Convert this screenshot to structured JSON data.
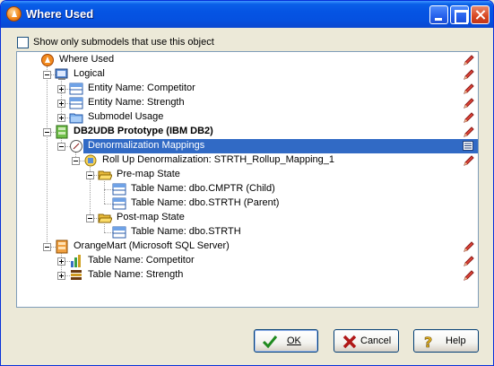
{
  "window": {
    "title": "Where Used"
  },
  "options": {
    "show_only_label": "Show only submodels that use this object",
    "show_only_checked": false
  },
  "tree": {
    "root": "Where Used",
    "logical": "Logical",
    "entity_competitor": "Entity Name: Competitor",
    "entity_strength": "Entity Name: Strength",
    "submodel_usage": "Submodel Usage",
    "db2": "DB2UDB Prototype (IBM DB2)",
    "denorm": "Denormalization Mappings",
    "rollup": "Roll Up Denormalization: STRTH_Rollup_Mapping_1",
    "premap": "Pre-map State",
    "cmptr_child": "Table Name: dbo.CMPTR (Child)",
    "strth_parent": "Table Name: dbo.STRTH (Parent)",
    "postmap": "Post-map State",
    "strth": "Table Name: dbo.STRTH",
    "orangemart": "OrangeMart (Microsoft SQL Server)",
    "table_competitor": "Table Name: Competitor",
    "table_strength": "Table Name: Strength"
  },
  "buttons": {
    "ok": "OK",
    "cancel": "Cancel",
    "help": "Help"
  },
  "colors": {
    "selection": "#316ac5",
    "titlebar": "#0554e3",
    "face": "#ece9d8"
  }
}
